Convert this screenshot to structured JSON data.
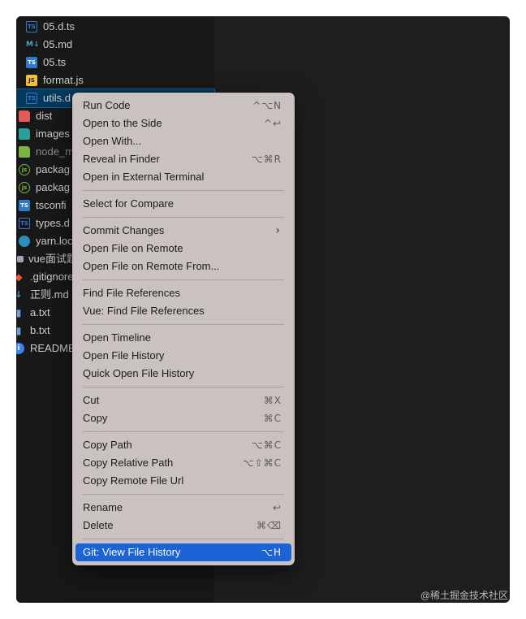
{
  "explorer": {
    "files": [
      {
        "name": "05.d.ts",
        "icon": "ts-outline-icon"
      },
      {
        "name": "05.md",
        "icon": "markdown-icon"
      },
      {
        "name": "05.ts",
        "icon": "typescript-icon"
      },
      {
        "name": "format.js",
        "icon": "javascript-icon"
      },
      {
        "name": "utils.d",
        "icon": "ts-outline-icon"
      },
      {
        "name": "dist",
        "icon": "folder-dist-icon"
      },
      {
        "name": "images",
        "icon": "folder-images-icon"
      },
      {
        "name": "node_m",
        "icon": "folder-node-icon"
      },
      {
        "name": "packag",
        "icon": "nodejs-icon"
      },
      {
        "name": "packag",
        "icon": "nodejs-icon"
      },
      {
        "name": "tsconfi",
        "icon": "tsconfig-icon"
      },
      {
        "name": "types.d",
        "icon": "ts-outline-icon"
      },
      {
        "name": "yarn.loc",
        "icon": "yarn-icon"
      },
      {
        "name": "vue面试题",
        "icon": "folder-icon"
      },
      {
        "name": ".gitignore",
        "icon": "git-icon"
      },
      {
        "name": "正则.md",
        "icon": "markdown-icon"
      },
      {
        "name": "a.txt",
        "icon": "text-file-icon"
      },
      {
        "name": "b.txt",
        "icon": "text-file-icon"
      },
      {
        "name": "README",
        "icon": "info-icon"
      }
    ]
  },
  "context_menu": {
    "items": [
      {
        "label": "Run Code",
        "shortcut": "^⌥N"
      },
      {
        "label": "Open to the Side",
        "shortcut": "^↩"
      },
      {
        "label": "Open With...",
        "shortcut": ""
      },
      {
        "label": "Reveal in Finder",
        "shortcut": "⌥⌘R"
      },
      {
        "label": "Open in External Terminal",
        "shortcut": ""
      },
      {
        "label": "Select for Compare",
        "shortcut": ""
      },
      {
        "label": "Commit Changes",
        "shortcut": ""
      },
      {
        "label": "Open File on Remote",
        "shortcut": ""
      },
      {
        "label": "Open File on Remote From...",
        "shortcut": ""
      },
      {
        "label": "Find File References",
        "shortcut": ""
      },
      {
        "label": "Vue: Find File References",
        "shortcut": ""
      },
      {
        "label": "Open Timeline",
        "shortcut": ""
      },
      {
        "label": "Open File History",
        "shortcut": ""
      },
      {
        "label": "Quick Open File History",
        "shortcut": ""
      },
      {
        "label": "Cut",
        "shortcut": "⌘X"
      },
      {
        "label": "Copy",
        "shortcut": "⌘C"
      },
      {
        "label": "Copy Path",
        "shortcut": "⌥⌘C"
      },
      {
        "label": "Copy Relative Path",
        "shortcut": "⌥⇧⌘C"
      },
      {
        "label": "Copy Remote File Url",
        "shortcut": ""
      },
      {
        "label": "Rename",
        "shortcut": "↩"
      },
      {
        "label": "Delete",
        "shortcut": "⌘⌫"
      },
      {
        "label": "Git: View File History",
        "shortcut": "⌥H"
      }
    ],
    "submenu_icon": "chevron-right-icon"
  },
  "colors": {
    "menu_bg": "#c9c2c0",
    "highlight": "#1c63d6",
    "editor_bg": "#1e1e1e",
    "sidebar_bg": "#181818"
  },
  "watermark": "@稀土掘金技术社区"
}
